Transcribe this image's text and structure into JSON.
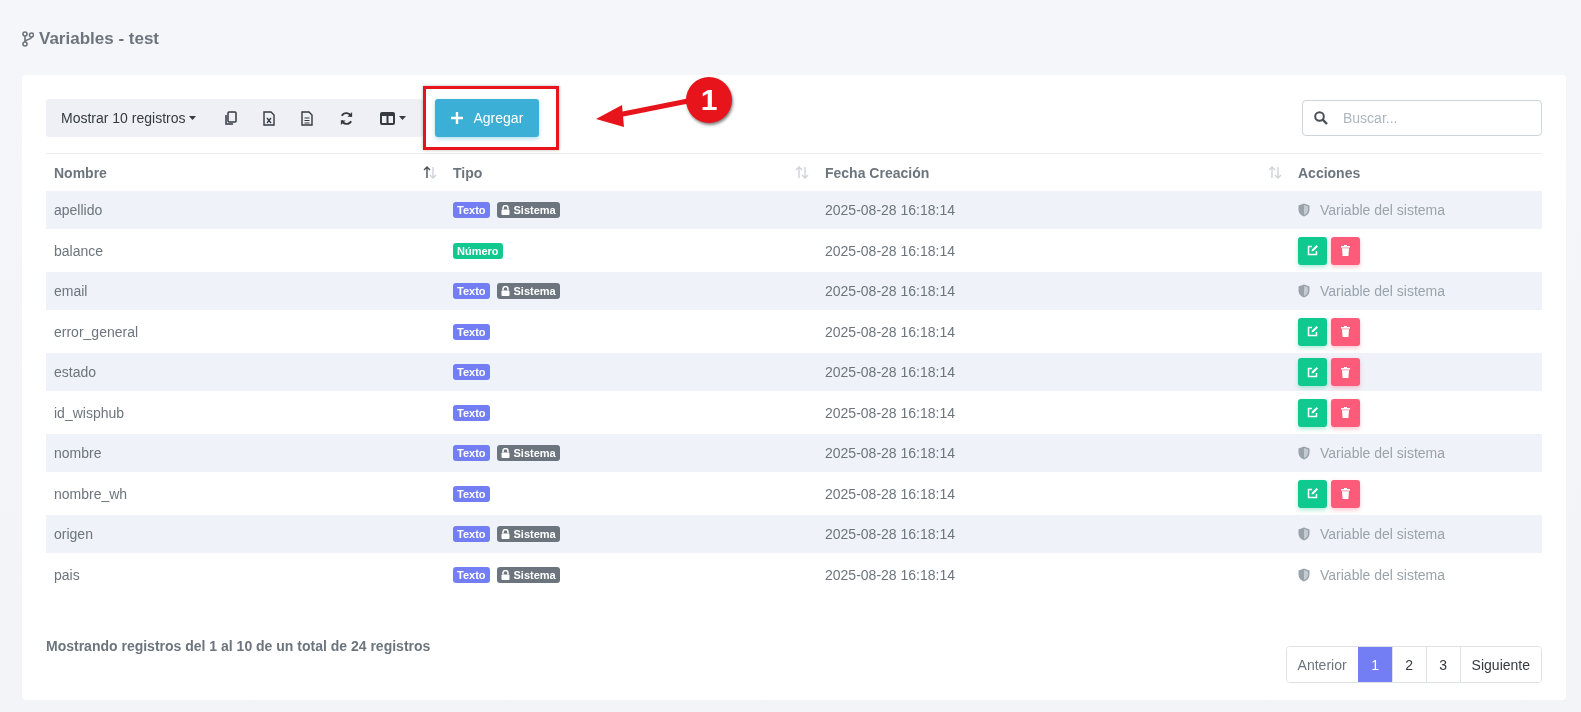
{
  "page_title": "Variables - test",
  "toolbar": {
    "length_menu": "Mostrar 10 registros",
    "add_button": "Agregar",
    "search": {
      "placeholder": "Buscar..."
    }
  },
  "annotation": {
    "number": "1"
  },
  "table": {
    "columns": [
      {
        "label": "Nombre",
        "sorted": true
      },
      {
        "label": "Tipo",
        "sorted": false
      },
      {
        "label": "Fecha Creación",
        "sorted": false
      },
      {
        "label": "Acciones"
      }
    ],
    "rows": [
      {
        "name": "apellido",
        "tags": [
          {
            "kind": "text",
            "label": "Texto"
          },
          {
            "kind": "system",
            "label": "Sistema"
          }
        ],
        "created": "2025-08-28 16:18:14",
        "system": true,
        "system_label": "Variable del sistema"
      },
      {
        "name": "balance",
        "tags": [
          {
            "kind": "number",
            "label": "Número"
          }
        ],
        "created": "2025-08-28 16:18:14",
        "system": false
      },
      {
        "name": "email",
        "tags": [
          {
            "kind": "text",
            "label": "Texto"
          },
          {
            "kind": "system",
            "label": "Sistema"
          }
        ],
        "created": "2025-08-28 16:18:14",
        "system": true,
        "system_label": "Variable del sistema"
      },
      {
        "name": "error_general",
        "tags": [
          {
            "kind": "text",
            "label": "Texto"
          }
        ],
        "created": "2025-08-28 16:18:14",
        "system": false
      },
      {
        "name": "estado",
        "tags": [
          {
            "kind": "text",
            "label": "Texto"
          }
        ],
        "created": "2025-08-28 16:18:14",
        "system": false
      },
      {
        "name": "id_wisphub",
        "tags": [
          {
            "kind": "text",
            "label": "Texto"
          }
        ],
        "created": "2025-08-28 16:18:14",
        "system": false
      },
      {
        "name": "nombre",
        "tags": [
          {
            "kind": "text",
            "label": "Texto"
          },
          {
            "kind": "system",
            "label": "Sistema"
          }
        ],
        "created": "2025-08-28 16:18:14",
        "system": true,
        "system_label": "Variable del sistema"
      },
      {
        "name": "nombre_wh",
        "tags": [
          {
            "kind": "text",
            "label": "Texto"
          }
        ],
        "created": "2025-08-28 16:18:14",
        "system": false
      },
      {
        "name": "origen",
        "tags": [
          {
            "kind": "text",
            "label": "Texto"
          },
          {
            "kind": "system",
            "label": "Sistema"
          }
        ],
        "created": "2025-08-28 16:18:14",
        "system": true,
        "system_label": "Variable del sistema"
      },
      {
        "name": "pais",
        "tags": [
          {
            "kind": "text",
            "label": "Texto"
          },
          {
            "kind": "system",
            "label": "Sistema"
          }
        ],
        "created": "2025-08-28 16:18:14",
        "system": true,
        "system_label": "Variable del sistema"
      }
    ]
  },
  "info": "Mostrando registros del 1 al 10 de un total de 24 registros",
  "pagination": {
    "previous": "Anterior",
    "pages": [
      {
        "label": "1",
        "selected": true
      },
      {
        "label": "2",
        "selected": false
      },
      {
        "label": "3",
        "selected": false
      }
    ],
    "next": "Siguiente"
  }
}
